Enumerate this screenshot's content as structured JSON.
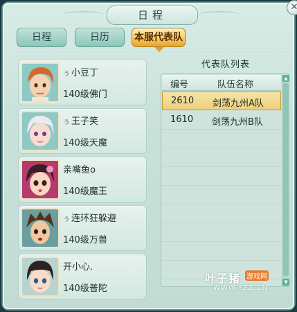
{
  "window": {
    "title": "日程",
    "close_symbol": "✕"
  },
  "tabs": [
    {
      "label": "日程",
      "active": false
    },
    {
      "label": "日历",
      "active": false
    },
    {
      "label": "本服代表队",
      "active": true
    }
  ],
  "members": [
    {
      "name": "小豆丁",
      "level": "140级佛门",
      "mark": "ぅ",
      "avatar": "boy-orange-hair-avatar"
    },
    {
      "name": "王子笑",
      "level": "140级天魔",
      "mark": "ぅ",
      "avatar": "girl-white-hair-avatar"
    },
    {
      "name": "亲嘴鱼o",
      "level": "140级魔王",
      "mark": "",
      "avatar": "girl-dark-hair-avatar"
    },
    {
      "name": "连环狂躲避",
      "level": "140级万兽",
      "mark": "ぅ",
      "avatar": "boy-brown-hair-avatar"
    },
    {
      "name": "开小心.",
      "level": "140级普陀",
      "mark": "",
      "avatar": "girl-black-hair-avatar"
    }
  ],
  "team_list": {
    "title": "代表队列表",
    "columns": [
      "编号",
      "队伍名称"
    ],
    "rows": [
      {
        "id": "2610",
        "name": "剑荡九州A队",
        "selected": true
      },
      {
        "id": "1610",
        "name": "剑荡九州B队",
        "selected": false
      }
    ]
  },
  "watermark": {
    "text": "叶子猪",
    "badge": "游戏网",
    "url": "WWW.YZZ.CN"
  },
  "colors": {
    "accent_tab": "#f3c65a",
    "selected_row": "#edcf7b",
    "panel": "#cfe3dd"
  }
}
